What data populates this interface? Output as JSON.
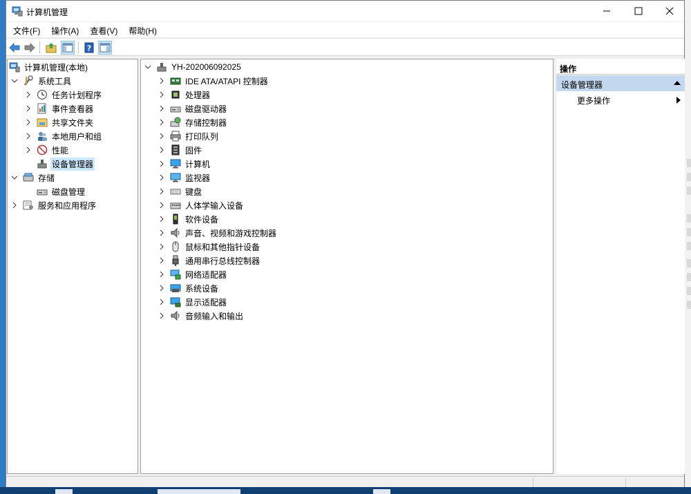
{
  "window": {
    "title": "计算机管理",
    "icon": "computer-management-icon",
    "controls": [
      "minimize-icon",
      "maximize-icon",
      "close-icon"
    ]
  },
  "menubar": {
    "items": [
      "文件(F)",
      "操作(A)",
      "查看(V)",
      "帮助(H)"
    ]
  },
  "toolbar": {
    "buttons": [
      "back-arrow-icon",
      "forward-arrow-icon",
      "up-folder-icon",
      "show-hide-console-tree-icon",
      "help-icon",
      "show-hide-action-pane-icon"
    ]
  },
  "left_tree": {
    "root": "计算机管理(本地)",
    "items": [
      {
        "label": "系统工具",
        "level": 1,
        "expanded": true,
        "icon": "tools-icon"
      },
      {
        "label": "任务计划程序",
        "level": 2,
        "icon": "clock-icon"
      },
      {
        "label": "事件查看器",
        "level": 2,
        "icon": "event-viewer-icon"
      },
      {
        "label": "共享文件夹",
        "level": 2,
        "icon": "shared-folder-icon"
      },
      {
        "label": "本地用户和组",
        "level": 2,
        "icon": "users-icon"
      },
      {
        "label": "性能",
        "level": 2,
        "icon": "performance-icon"
      },
      {
        "label": "设备管理器",
        "level": 2,
        "icon": "device-manager-icon",
        "selected": true
      },
      {
        "label": "存储",
        "level": 1,
        "expanded": true,
        "icon": "storage-icon"
      },
      {
        "label": "磁盘管理",
        "level": 2,
        "icon": "disk-icon"
      },
      {
        "label": "服务和应用程序",
        "level": 1,
        "icon": "services-icon"
      }
    ]
  },
  "device_tree": {
    "computer_name": "YH-202006092025",
    "categories": [
      {
        "label": "IDE ATA/ATAPI 控制器",
        "icon": "ide-controller-icon"
      },
      {
        "label": "处理器",
        "icon": "processor-icon"
      },
      {
        "label": "磁盘驱动器",
        "icon": "disk-drive-icon"
      },
      {
        "label": "存储控制器",
        "icon": "storage-controller-icon"
      },
      {
        "label": "打印队列",
        "icon": "printer-icon"
      },
      {
        "label": "固件",
        "icon": "firmware-icon"
      },
      {
        "label": "计算机",
        "icon": "computer-icon"
      },
      {
        "label": "监视器",
        "icon": "monitor-icon"
      },
      {
        "label": "键盘",
        "icon": "keyboard-icon"
      },
      {
        "label": "人体学输入设备",
        "icon": "hid-icon"
      },
      {
        "label": "软件设备",
        "icon": "software-device-icon"
      },
      {
        "label": "声音、视频和游戏控制器",
        "icon": "speaker-icon"
      },
      {
        "label": "鼠标和其他指针设备",
        "icon": "mouse-icon"
      },
      {
        "label": "通用串行总线控制器",
        "icon": "usb-icon"
      },
      {
        "label": "网络适配器",
        "icon": "network-adapter-icon"
      },
      {
        "label": "系统设备",
        "icon": "system-device-icon"
      },
      {
        "label": "显示适配器",
        "icon": "display-adapter-icon"
      },
      {
        "label": "音频输入和输出",
        "icon": "audio-io-icon"
      }
    ]
  },
  "actions": {
    "header": "操作",
    "section": "设备管理器",
    "more": "更多操作"
  },
  "colors": {
    "selection": "#cce8ff",
    "action_section": "#c3d8ee",
    "desktop": "#1c6fb5"
  }
}
